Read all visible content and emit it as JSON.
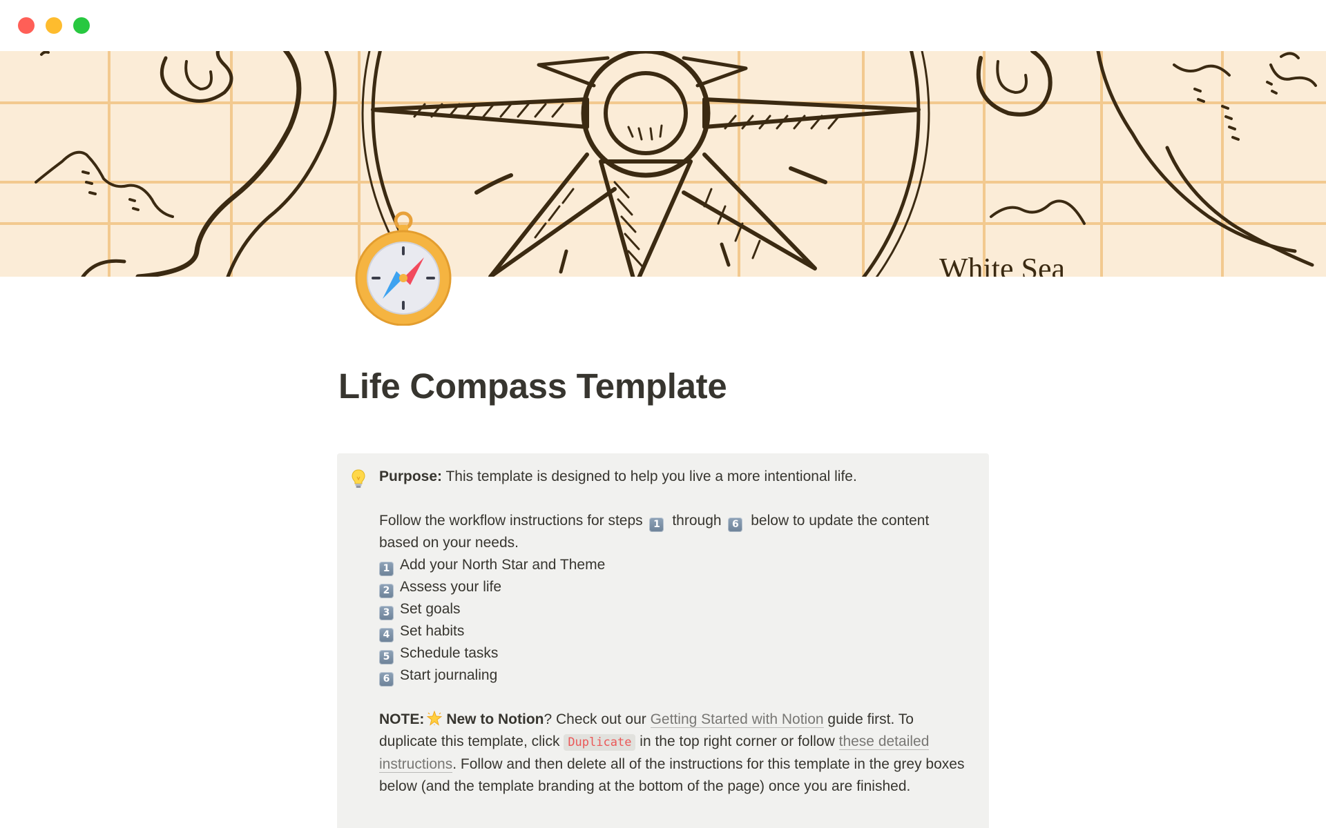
{
  "window": {
    "controls": [
      "close",
      "minimize",
      "zoom"
    ]
  },
  "cover": {
    "map_label": "White Sea"
  },
  "page": {
    "icon": "compass-icon",
    "title": "Life Compass Template"
  },
  "callout": {
    "icon": "lightbulb-icon",
    "purpose_label": "Purpose:",
    "purpose_text": "This template is designed to help you live a more intentional life.",
    "follow_prefix": "Follow the workflow instructions for steps",
    "follow_start_step": "1",
    "follow_middle": "through",
    "follow_end_step": "6",
    "follow_suffix": "below to update the content based on your needs.",
    "steps": [
      {
        "number": "1",
        "label": "Add your North Star and Theme"
      },
      {
        "number": "2",
        "label": "Assess your life"
      },
      {
        "number": "3",
        "label": "Set goals"
      },
      {
        "number": "4",
        "label": "Set habits"
      },
      {
        "number": "5",
        "label": "Schedule tasks"
      },
      {
        "number": "6",
        "label": "Start journaling"
      }
    ],
    "note": {
      "note_label": "NOTE:",
      "new_label": "New to Notion",
      "after_new": "? Check out our",
      "guide_link": "Getting Started with Notion",
      "after_guide": "guide first. To duplicate this template, click",
      "duplicate_code": "Duplicate",
      "after_duplicate": "in the top right corner or follow",
      "instructions_link": "these detailed instructions",
      "after_instructions": ". Follow and then delete all of the instructions for this template in the grey boxes below (and the template branding at the bottom of the page) once you are finished."
    }
  },
  "colors": {
    "cover_background": "#fbecd7",
    "cover_ink": "#3b2a12",
    "grid_line": "#f2c98f",
    "callout_background": "#f1f1ef",
    "code_text": "#eb5757",
    "link_text": "#787774"
  }
}
